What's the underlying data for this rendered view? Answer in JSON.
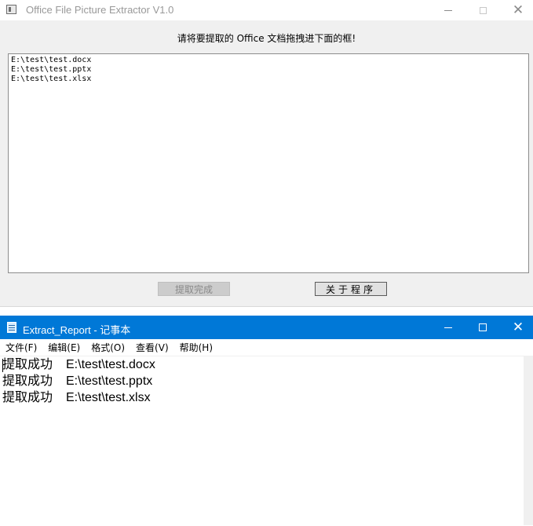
{
  "extractor": {
    "title": "Office File Picture Extractor V1.0",
    "prompt": "请将要提取的 Office 文档拖拽进下面的框!",
    "files": [
      "E:\\test\\test.docx",
      "E:\\test\\test.pptx",
      "E:\\test\\test.xlsx"
    ],
    "done_button": "提取完成",
    "about_button": "关于程序"
  },
  "notepad": {
    "title": "Extract_Report - 记事本",
    "menu": [
      "文件(F)",
      "编辑(E)",
      "格式(O)",
      "查看(V)",
      "帮助(H)"
    ],
    "lines": [
      {
        "status": "提取成功",
        "path": "E:\\test\\test.docx"
      },
      {
        "status": "提取成功",
        "path": "E:\\test\\test.pptx"
      },
      {
        "status": "提取成功",
        "path": "E:\\test\\test.xlsx"
      }
    ]
  },
  "icons": {
    "minimize": "minimize-icon",
    "maximize": "maximize-icon",
    "close": "close-icon",
    "app": "app-icon",
    "notepad": "notepad-icon"
  },
  "colors": {
    "notepad_titlebar": "#0078d7",
    "dialog_bg": "#f0f0f0"
  }
}
